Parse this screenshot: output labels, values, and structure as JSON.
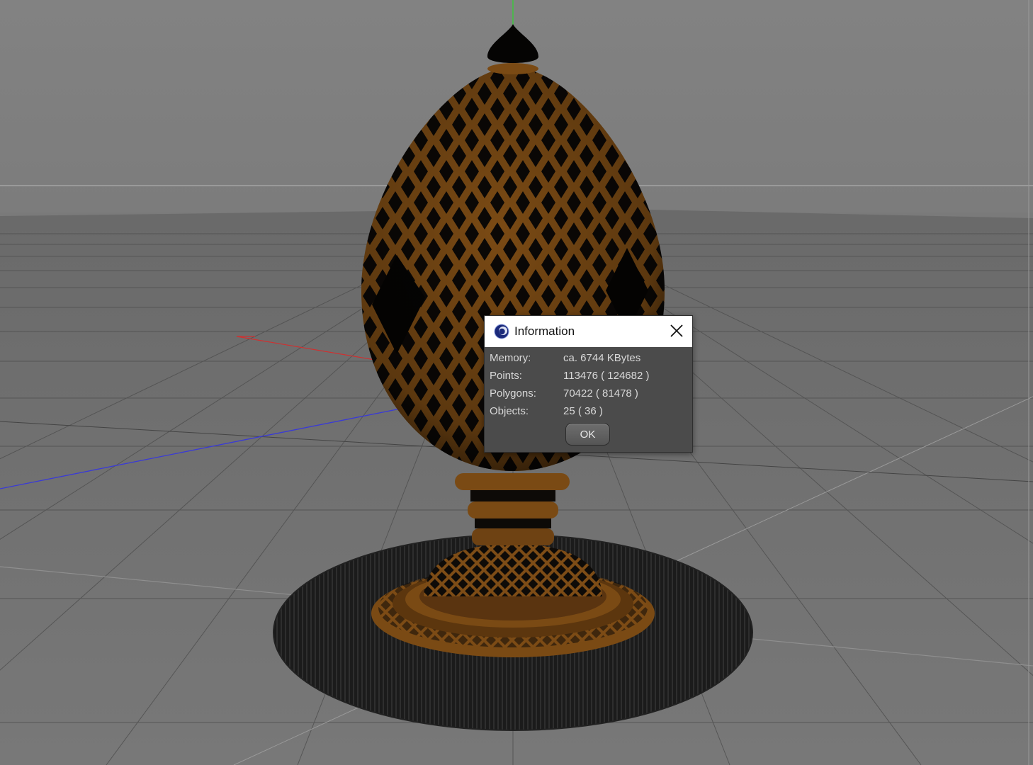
{
  "viewport": {
    "background_color": "#7a7a7a",
    "model_color": "#8a5218"
  },
  "dialog": {
    "title": "Information",
    "logo_icon": "cinema4d-logo-icon",
    "close_icon": "close-icon",
    "rows": [
      {
        "label": "Memory:",
        "value": "ca. 6744 KBytes"
      },
      {
        "label": "Points:",
        "value": "113476 ( 124682 )"
      },
      {
        "label": "Polygons:",
        "value": "70422 ( 81478 )"
      },
      {
        "label": "Objects:",
        "value": "25 ( 36 )"
      }
    ],
    "ok_label": "OK"
  }
}
